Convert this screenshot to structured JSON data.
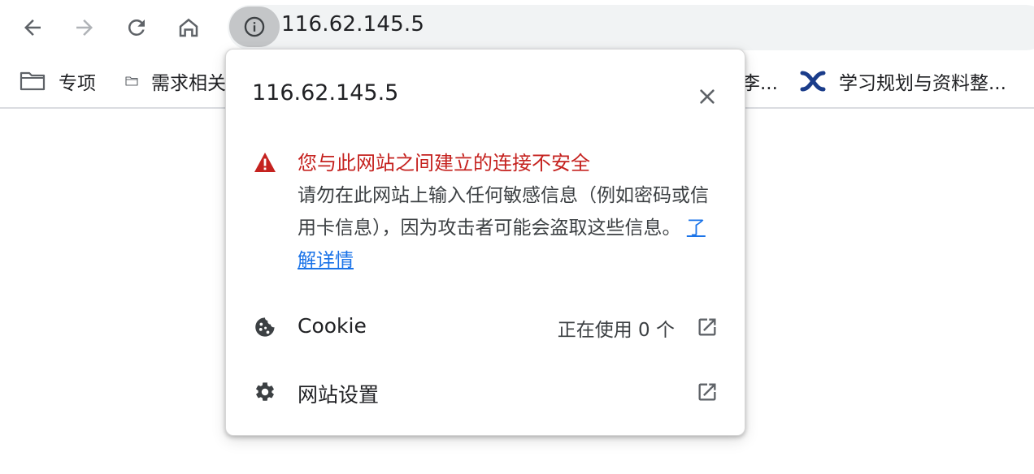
{
  "toolbar": {
    "back_icon": "arrow-left-icon",
    "forward_icon": "arrow-right-icon",
    "reload_icon": "reload-icon",
    "home_icon": "home-icon",
    "site_info_icon": "info-icon",
    "url": "116.62.145.5"
  },
  "bookmarks": {
    "items": [
      {
        "label": "专项",
        "icon": "folder-icon"
      },
      {
        "label": "需求相关",
        "icon": "folder-icon"
      },
      {
        "label": "李...",
        "icon": ""
      },
      {
        "label": "学习规划与资料整...",
        "icon": "confluence-icon"
      }
    ]
  },
  "popup": {
    "title": "116.62.145.5",
    "close_icon": "close-icon",
    "warning": {
      "icon": "warning-triangle-icon",
      "title": "您与此网站之间建立的连接不安全",
      "body": "请勿在此网站上输入任何敏感信息（例如密码或信用卡信息），因为攻击者可能会盗取这些信息。",
      "learn_more": "了解详情"
    },
    "cookie_row": {
      "icon": "cookie-icon",
      "label": "Cookie",
      "value": "正在使用 0 个",
      "ext_icon": "open-in-new-icon"
    },
    "settings_row": {
      "icon": "gear-icon",
      "label": "网站设置",
      "ext_icon": "open-in-new-icon"
    }
  },
  "colors": {
    "warning_red": "#c5221f",
    "link_blue": "#1a73e8",
    "omnibox_bg": "#f1f3f4",
    "icon_gray": "#5f6368"
  }
}
